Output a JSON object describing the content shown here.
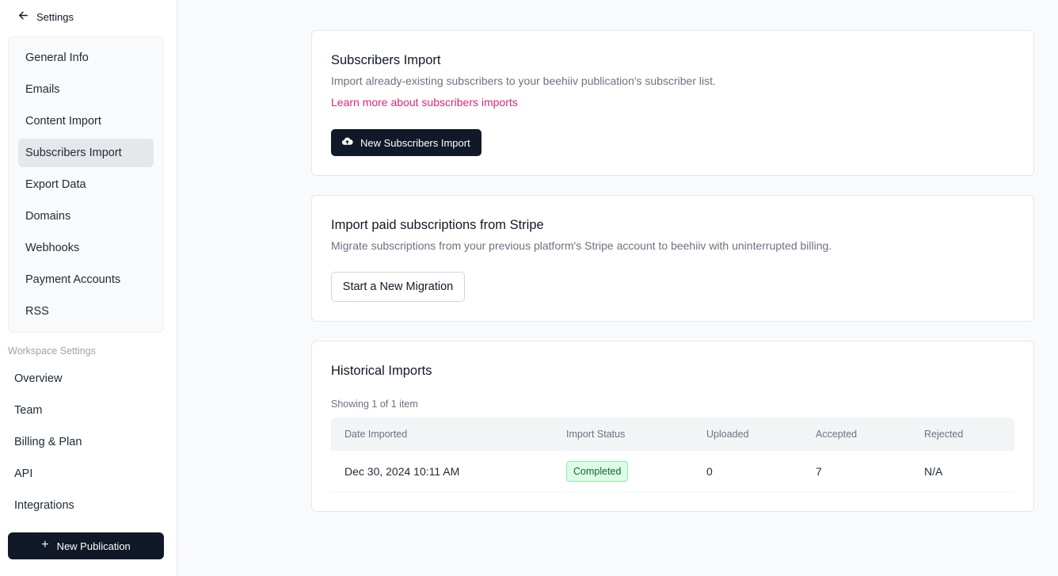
{
  "sidebar": {
    "back_label": "Settings",
    "publication_items": [
      {
        "label": "General Info"
      },
      {
        "label": "Emails"
      },
      {
        "label": "Content Import"
      },
      {
        "label": "Subscribers Import",
        "active": true
      },
      {
        "label": "Export Data"
      },
      {
        "label": "Domains"
      },
      {
        "label": "Webhooks"
      },
      {
        "label": "Payment Accounts"
      },
      {
        "label": "RSS"
      }
    ],
    "workspace_label": "Workspace Settings",
    "workspace_items": [
      {
        "label": "Overview"
      },
      {
        "label": "Team"
      },
      {
        "label": "Billing & Plan"
      },
      {
        "label": "API"
      },
      {
        "label": "Integrations"
      }
    ],
    "new_publication_label": "New Publication"
  },
  "subscribers_import": {
    "title": "Subscribers Import",
    "description": "Import already-existing subscribers to your beehiiv publication's subscriber list.",
    "link": "Learn more about subscribers imports",
    "button_label": "New Subscribers Import",
    "button_icon": "cloud-upload-icon"
  },
  "stripe_import": {
    "title": "Import paid subscriptions from Stripe",
    "description": "Migrate subscriptions from your previous platform's Stripe account to beehiiv with uninterrupted billing.",
    "button_label": "Start a New Migration"
  },
  "historical": {
    "title": "Historical Imports",
    "showing": "Showing 1 of 1 item",
    "columns": [
      "Date Imported",
      "Import Status",
      "Uploaded",
      "Accepted",
      "Rejected"
    ],
    "rows": [
      {
        "date": "Dec 30, 2024 10:11 AM",
        "status": "Completed",
        "uploaded": "0",
        "accepted": "7",
        "rejected": "N/A"
      }
    ]
  },
  "colors": {
    "accent_link": "#db2777",
    "primary_button": "#111827",
    "status_completed_bg": "#dcfce7",
    "status_completed_text": "#166534"
  }
}
